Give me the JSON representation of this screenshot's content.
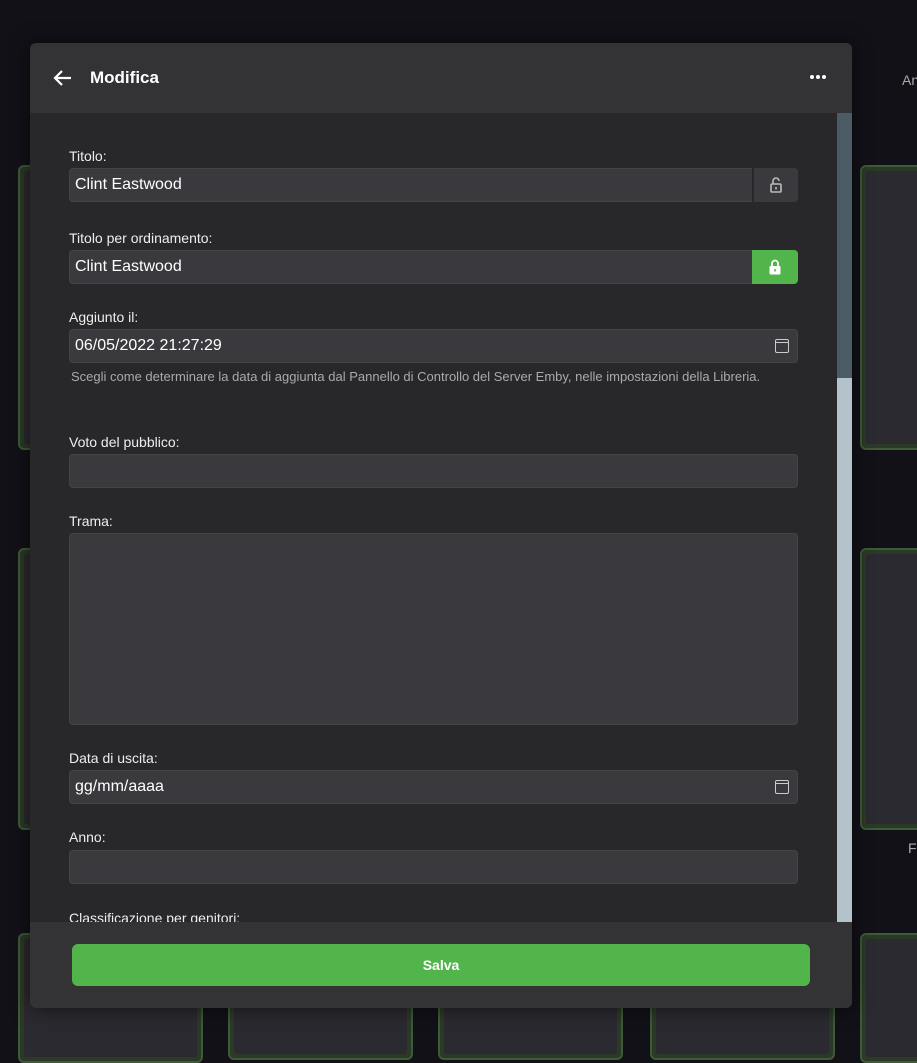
{
  "background": {
    "labels": [
      "An",
      "F"
    ]
  },
  "dialog": {
    "title": "Modifica",
    "fields": {
      "title": {
        "label": "Titolo:",
        "value": "Clint Eastwood"
      },
      "sort_title": {
        "label": "Titolo per ordinamento:",
        "value": "Clint Eastwood"
      },
      "date_added": {
        "label": "Aggiunto il:",
        "value": "06/05/2022 21:27:29",
        "help": "Scegli come determinare la data di aggiunta dal Pannello di Controllo del Server Emby, nelle impostazioni della Libreria."
      },
      "community_rating": {
        "label": "Voto del pubblico:",
        "value": ""
      },
      "overview": {
        "label": "Trama:",
        "value": ""
      },
      "release_date": {
        "label": "Data di uscita:",
        "placeholder": "gg/mm/aaaa"
      },
      "year": {
        "label": "Anno:",
        "value": ""
      },
      "parental_rating": {
        "label": "Classificazione per genitori:"
      }
    },
    "save_label": "Salva"
  },
  "colors": {
    "accent": "#52b54b",
    "dialog_bg": "#28282a",
    "header_bg": "#333335"
  }
}
